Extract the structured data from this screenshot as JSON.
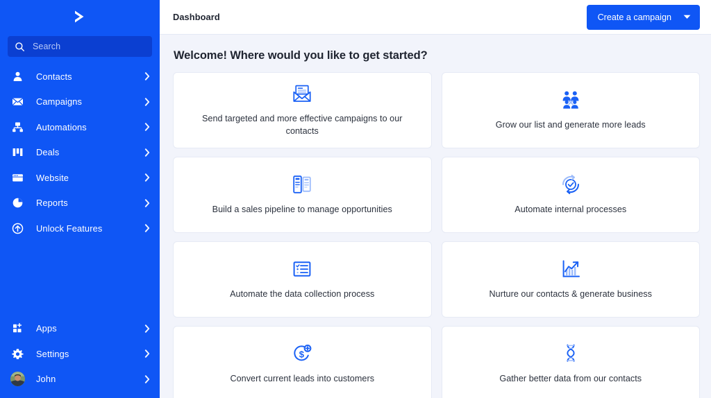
{
  "brand": {
    "logo_name": "activecampaign-chevron-logo",
    "primary_color": "#0f56f5",
    "search_bg_color": "#0b3fd1",
    "page_bg_color": "#f2f4fb",
    "card_bg_color": "#ffffff",
    "icon_color": "#1a61f5"
  },
  "sidebar": {
    "search": {
      "placeholder": "Search",
      "value": ""
    },
    "items": [
      {
        "label": "Contacts",
        "icon": "person-icon"
      },
      {
        "label": "Campaigns",
        "icon": "envelope-icon"
      },
      {
        "label": "Automations",
        "icon": "org-chart-icon"
      },
      {
        "label": "Deals",
        "icon": "columns-icon"
      },
      {
        "label": "Website",
        "icon": "browser-window-icon"
      },
      {
        "label": "Reports",
        "icon": "pie-chart-icon"
      },
      {
        "label": "Unlock Features",
        "icon": "arrow-up-circle-icon"
      }
    ],
    "bottom_items": [
      {
        "label": "Apps",
        "icon": "apps-grid-plus-icon"
      },
      {
        "label": "Settings",
        "icon": "gear-icon"
      },
      {
        "label": "John",
        "icon": "user-avatar"
      }
    ]
  },
  "topbar": {
    "title": "Dashboard",
    "cta_label": "Create a campaign",
    "cta_caret": "chevron-down-icon"
  },
  "main": {
    "heading": "Welcome! Where would you like to get started?",
    "cards": [
      {
        "label": "Send targeted and more effective campaigns to our contacts",
        "icon": "open-envelope-icon"
      },
      {
        "label": "Grow our list and generate more leads",
        "icon": "two-people-icon"
      },
      {
        "label": "Build a sales pipeline to manage opportunities",
        "icon": "pipeline-cards-icon"
      },
      {
        "label": "Automate internal processes",
        "icon": "sync-check-icon"
      },
      {
        "label": "Automate the data collection process",
        "icon": "checklist-icon"
      },
      {
        "label": "Nurture our contacts & generate business",
        "icon": "growth-chart-icon"
      },
      {
        "label": "Convert current leads into customers",
        "icon": "dollar-plus-icon"
      },
      {
        "label": "Gather better data from our contacts",
        "icon": "dna-helix-icon"
      }
    ]
  }
}
